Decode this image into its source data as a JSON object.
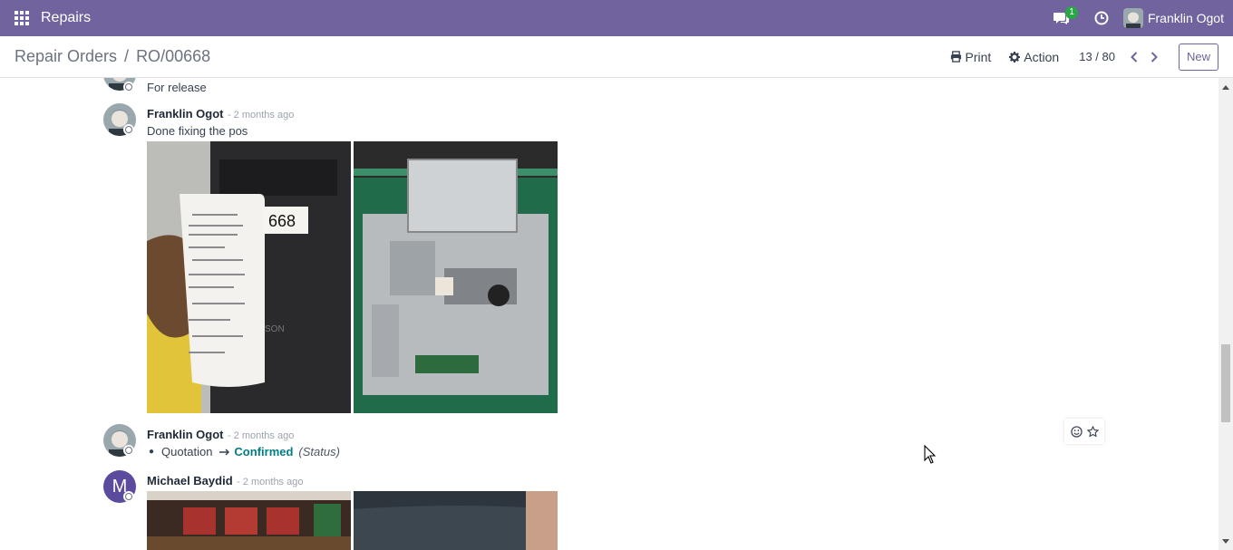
{
  "navbar": {
    "app_name": "Repairs",
    "messages_badge": "1",
    "user_name": "Franklin Ogot",
    "bg_color": "#71639e"
  },
  "control_panel": {
    "breadcrumb_parent": "Repair Orders",
    "breadcrumb_sep": "/",
    "breadcrumb_current": "RO/00668",
    "print_label": "Print",
    "action_label": "Action",
    "pager": "13 / 80",
    "new_label": "New"
  },
  "chatter": {
    "messages": [
      {
        "author": "",
        "date": "",
        "body": "For release"
      },
      {
        "author": "Franklin Ogot",
        "date": "- 2 months ago",
        "body": "Done fixing the pos"
      },
      {
        "author": "Franklin Ogot",
        "date": "- 2 months ago",
        "tracking": {
          "old": "Quotation",
          "new": "Confirmed",
          "field": "(Status)"
        }
      },
      {
        "author": "Michael Baydid",
        "date": "- 2 months ago",
        "avatar_letter": "M"
      }
    ]
  },
  "icons": [
    "apps-grid-icon",
    "chat-icon",
    "clock-icon",
    "print-icon",
    "gear-icon",
    "chevron-left-icon",
    "chevron-right-icon",
    "smiley-icon",
    "star-icon",
    "cursor-icon"
  ],
  "colors": {
    "accent": "#71639e",
    "tracking_new": "#017e84",
    "avatar_m": "#5b4a9e"
  }
}
